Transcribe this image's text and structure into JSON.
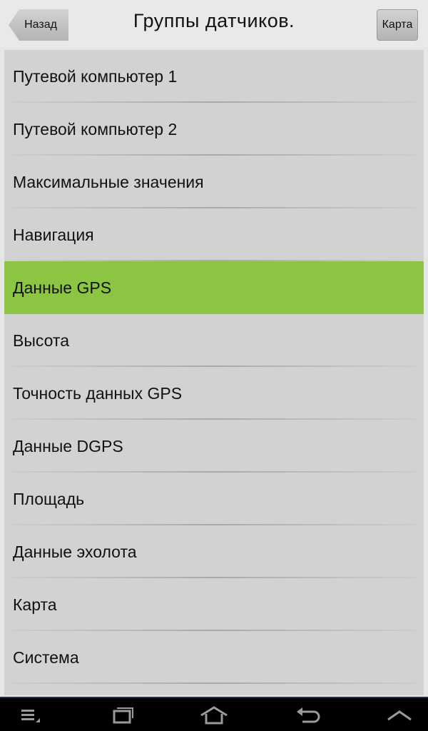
{
  "header": {
    "back_label": "Назад",
    "title": "Группы датчиков.",
    "map_label": "Карта"
  },
  "list": {
    "items": [
      {
        "label": "Путевой компьютер 1",
        "selected": false
      },
      {
        "label": "Путевой компьютер 2",
        "selected": false
      },
      {
        "label": "Максимальные значения",
        "selected": false
      },
      {
        "label": "Навигация",
        "selected": false
      },
      {
        "label": "Данные GPS",
        "selected": true
      },
      {
        "label": "Высота",
        "selected": false
      },
      {
        "label": "Точность данных GPS",
        "selected": false
      },
      {
        "label": "Данные DGPS",
        "selected": false
      },
      {
        "label": "Площадь",
        "selected": false
      },
      {
        "label": "Данные эхолота",
        "selected": false
      },
      {
        "label": "Карта",
        "selected": false
      },
      {
        "label": "Система",
        "selected": false
      }
    ]
  },
  "colors": {
    "selected_row": "#8bc541",
    "list_background": "#d2d2d2",
    "nav_bar": "#000000"
  },
  "nav_bar": {
    "icons": [
      "menu-icon",
      "recent-apps-icon",
      "home-icon",
      "back-icon",
      "chevron-up-icon"
    ]
  }
}
